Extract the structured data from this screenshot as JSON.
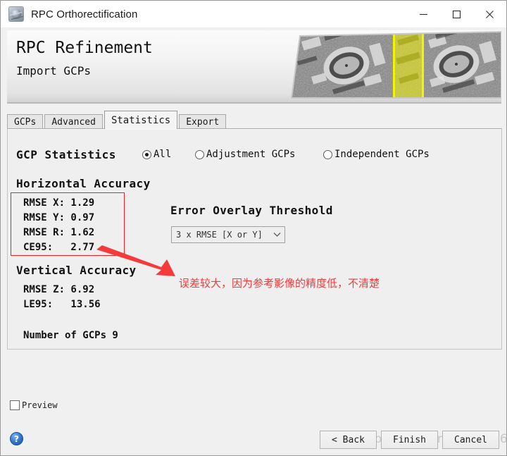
{
  "window": {
    "title": "RPC Orthorectification",
    "icon": "globe-icon",
    "minimize_label": "—",
    "maximize_label": "□",
    "close_label": "✕"
  },
  "banner": {
    "title": "RPC Refinement",
    "subtitle": "Import GCPs",
    "image_alt": "satellite-stadium-imagery"
  },
  "tabs": [
    {
      "label": "GCPs",
      "active": false
    },
    {
      "label": "Advanced",
      "active": false
    },
    {
      "label": "Statistics",
      "active": true
    },
    {
      "label": "Export",
      "active": false
    }
  ],
  "statistics": {
    "group_label": "GCP Statistics",
    "radios": [
      {
        "label": "All",
        "selected": true
      },
      {
        "label": "Adjustment GCPs",
        "selected": false
      },
      {
        "label": "Independent GCPs",
        "selected": false
      }
    ],
    "horizontal": {
      "heading": "Horizontal Accuracy",
      "rows": [
        "RMSE X: 1.29",
        "RMSE Y: 0.97",
        "RMSE R: 1.62",
        "CE95:   2.77"
      ]
    },
    "vertical": {
      "heading": "Vertical Accuracy",
      "rows": [
        "RMSE Z: 6.92",
        "LE95:   13.56"
      ]
    },
    "gcp_count_line": "Number of GCPs 9",
    "threshold": {
      "label": "Error Overlay Threshold",
      "value": "3 x RMSE [X or Y]",
      "arrow_icon": "chevron-down-icon"
    }
  },
  "annotation": {
    "text": "误差较大，因为参考影像的精度低，不清楚",
    "color": "#f43a3a",
    "box_color": "#ee2222"
  },
  "footer": {
    "preview_label": "Preview",
    "preview_checked": false,
    "help_label": "?",
    "buttons": [
      {
        "label": "< Back"
      },
      {
        "label": "Finish"
      },
      {
        "label": "Cancel"
      }
    ],
    "watermark": "https://blog.csdn.net/y_j_6666"
  }
}
